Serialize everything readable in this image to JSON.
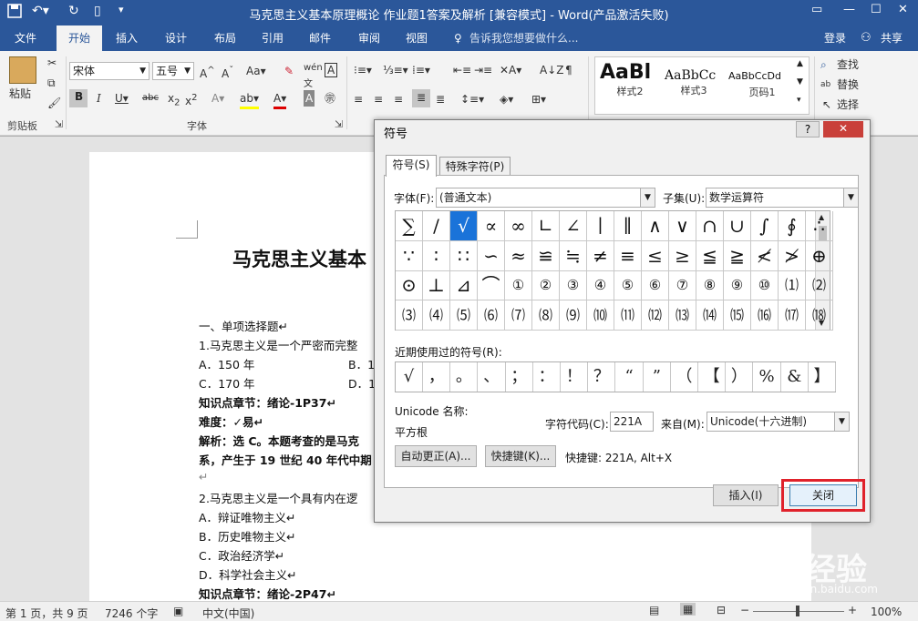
{
  "window": {
    "title": "马克思主义基本原理概论  作业题1答案及解析 [兼容模式] - Word(产品激活失败)"
  },
  "tabs": [
    "文件",
    "开始",
    "插入",
    "设计",
    "布局",
    "引用",
    "邮件",
    "审阅",
    "视图"
  ],
  "tellme": "告诉我您想要做什么...",
  "login": "登录",
  "share": "共享",
  "ribbon": {
    "paste": "粘贴",
    "clipboard": "剪贴板",
    "font_group": "字体",
    "font_name": "宋体",
    "font_size": "五号",
    "styles": [
      {
        "preview": "AaBl",
        "name": "样式2"
      },
      {
        "preview": "AaBbCc",
        "name": "样式3"
      },
      {
        "preview": "AaBbCcDd",
        "name": "页码1"
      }
    ],
    "find": "查找",
    "replace": "替换",
    "select": "选择"
  },
  "doc": {
    "title": "马克思主义基本",
    "lines": [
      {
        "t": "一、单项选择题↵",
        "b": false
      },
      {
        "t": "1.马克思主义是一个严密而完整",
        "b": false
      },
      {
        "t": "A．150 年",
        "b": false
      },
      {
        "t": "C．170 年",
        "b": false
      },
      {
        "t": "知识点章节：绪论-1P37↵",
        "b": true
      },
      {
        "t": "难度：✓易↵",
        "b": true
      },
      {
        "t": "解析：选 C。本题考查的是马克",
        "b": true
      },
      {
        "t": "系，产生于 19 世纪 40 年代中期",
        "b": true
      },
      {
        "t": "↵",
        "b": false
      },
      {
        "t": "2.马克思主义是一个具有内在逻",
        "b": false
      },
      {
        "t": "A．辩证唯物主义↵",
        "b": false
      },
      {
        "t": "B．历史唯物主义↵",
        "b": false
      },
      {
        "t": "C．政治经济学↵",
        "b": false
      },
      {
        "t": "D．科学社会主义↵",
        "b": false
      },
      {
        "t": "知识点章节：绪论-2P47↵",
        "b": true
      }
    ],
    "optB": "B．1",
    "optD": "D．1"
  },
  "status": {
    "page": "第 1 页，共 9 页",
    "words": "7246 个字",
    "lang": "中文(中国)",
    "zoom": "100%"
  },
  "dialog": {
    "title": "符号",
    "help": "?",
    "tab1": "符号(S)",
    "tab2": "特殊字符(P)",
    "font_label": "字体(F):",
    "font_value": "(普通文本)",
    "subset_label": "子集(U):",
    "subset_value": "数学运算符",
    "symbols": [
      "∑",
      "/",
      "√",
      "∝",
      "∞",
      "∟",
      "∠",
      "∣",
      "∥",
      "∧",
      "∨",
      "∩",
      "∪",
      "∫",
      "∮",
      "∴",
      "∵",
      "∶",
      "∷",
      "∽",
      "≈",
      "≌",
      "≒",
      "≠",
      "≡",
      "≤",
      "≥",
      "≦",
      "≧",
      "≮",
      "≯",
      "⊕",
      "⊙",
      "⊥",
      "⊿",
      "⌒",
      "①",
      "②",
      "③",
      "④",
      "⑤",
      "⑥",
      "⑦",
      "⑧",
      "⑨",
      "⑩",
      "⑴",
      "⑵",
      "⑶",
      "⑷",
      "⑸",
      "⑹",
      "⑺",
      "⑻",
      "⑼",
      "⑽",
      "⑾",
      "⑿",
      "⒀",
      "⒁",
      "⒂",
      "⒃",
      "⒄",
      "⒅"
    ],
    "selected": 2,
    "recent_label": "近期使用过的符号(R):",
    "recent": [
      "√",
      "，",
      "。",
      "、",
      "；",
      "：",
      "！",
      "？",
      "“",
      "”",
      "（",
      "【",
      "）",
      "%",
      "&",
      "】"
    ],
    "unicode_label": "Unicode 名称:",
    "unicode_name": "平方根",
    "code_label": "字符代码(C):",
    "code_value": "221A",
    "from_label": "来自(M):",
    "from_value": "Unicode(十六进制)",
    "autocorrect": "自动更正(A)...",
    "shortcut_key": "快捷键(K)...",
    "shortcut_text": "快捷键: 221A, Alt+X",
    "insert": "插入(I)",
    "close": "关闭"
  },
  "watermark": {
    "main": "Baidu经验",
    "sub": "jingyan.baidu.com"
  },
  "colors": {
    "word_blue": "#2b579a",
    "highlight_red": "#e0222b",
    "selected_cell": "#1a73d9"
  }
}
